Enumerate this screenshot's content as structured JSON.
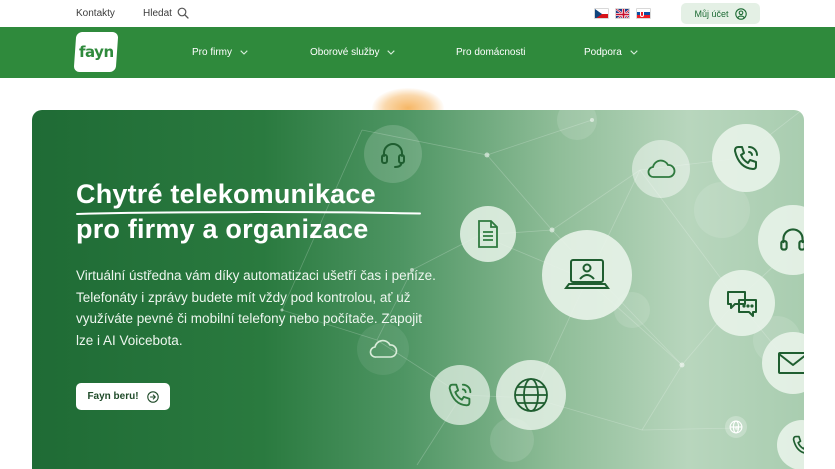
{
  "topbar": {
    "contacts": "Kontakty",
    "search": "Hledat",
    "languages": [
      "cs",
      "en",
      "sk"
    ],
    "account": "Můj účet"
  },
  "nav": {
    "logo": "fayn",
    "items": [
      {
        "label": "Pro firmy",
        "has_dropdown": true
      },
      {
        "label": "Oborové služby",
        "has_dropdown": true
      },
      {
        "label": "Pro domácnosti",
        "has_dropdown": false
      },
      {
        "label": "Podpora",
        "has_dropdown": true
      }
    ]
  },
  "hero": {
    "title_line1": "Chytré telekomunikace",
    "title_line2": "pro firmy a organizace",
    "description": "Virtuální ústředna vám díky automatizaci ušetří čas i peníze. Telefonáty i zprávy budete mít vždy pod kontrolou, ať už využíváte pevné či mobilní telefony nebo počítače. Zapojit lze i AI Voicebota.",
    "cta": "Fayn beru!",
    "icons": [
      "headset-icon",
      "cloud-icon",
      "phone-icon",
      "document-icon",
      "laptop-user-icon",
      "chat-icon",
      "envelope-icon",
      "globe-icon"
    ]
  },
  "colors": {
    "brand_green": "#2f8a3c",
    "hero_dark_green": "#1f6b35",
    "account_bg": "#e4f0e5"
  }
}
